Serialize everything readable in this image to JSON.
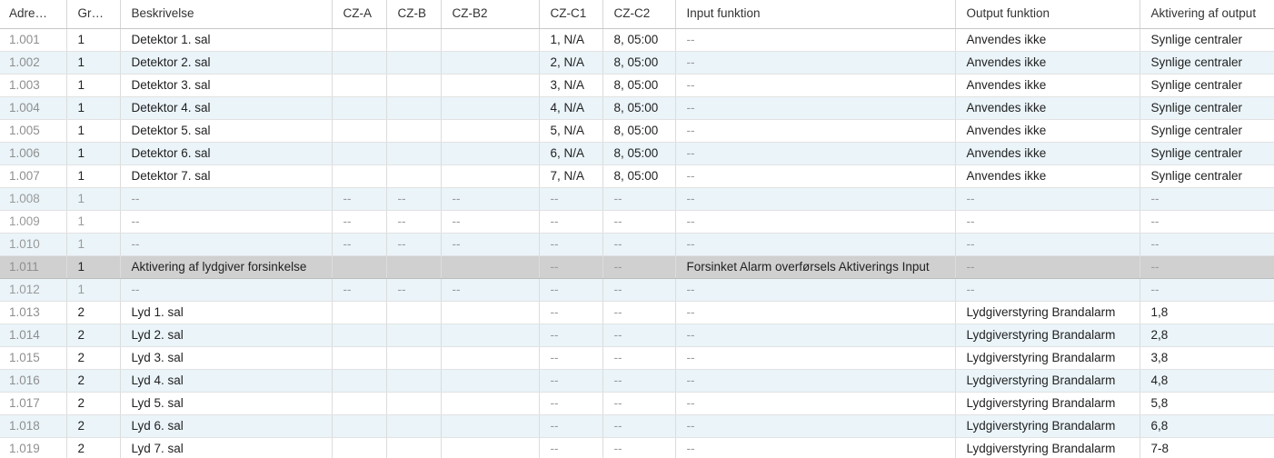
{
  "columns": [
    "Adre…",
    "Gr…",
    "Beskrivelse",
    "CZ-A",
    "CZ-B",
    "CZ-B2",
    "CZ-C1",
    "CZ-C2",
    "Input funktion",
    "Output funktion",
    "Aktivering af output"
  ],
  "rows": [
    {
      "state": "normal",
      "cells": [
        "1.001",
        "1",
        "Detektor 1. sal",
        "",
        "",
        "",
        "1, N/A",
        "8, 05:00",
        "--",
        "Anvendes ikke",
        "Synlige centraler"
      ]
    },
    {
      "state": "normal",
      "cells": [
        "1.002",
        "1",
        "Detektor 2. sal",
        "",
        "",
        "",
        "2, N/A",
        "8, 05:00",
        "--",
        "Anvendes ikke",
        "Synlige centraler"
      ]
    },
    {
      "state": "normal",
      "cells": [
        "1.003",
        "1",
        "Detektor 3. sal",
        "",
        "",
        "",
        "3, N/A",
        "8, 05:00",
        "--",
        "Anvendes ikke",
        "Synlige centraler"
      ]
    },
    {
      "state": "normal",
      "cells": [
        "1.004",
        "1",
        "Detektor 4. sal",
        "",
        "",
        "",
        "4, N/A",
        "8, 05:00",
        "--",
        "Anvendes ikke",
        "Synlige centraler"
      ]
    },
    {
      "state": "normal",
      "cells": [
        "1.005",
        "1",
        "Detektor 5. sal",
        "",
        "",
        "",
        "5, N/A",
        "8, 05:00",
        "--",
        "Anvendes ikke",
        "Synlige centraler"
      ]
    },
    {
      "state": "normal",
      "cells": [
        "1.006",
        "1",
        "Detektor 6. sal",
        "",
        "",
        "",
        "6, N/A",
        "8, 05:00",
        "--",
        "Anvendes ikke",
        "Synlige centraler"
      ]
    },
    {
      "state": "normal",
      "cells": [
        "1.007",
        "1",
        "Detektor 7. sal",
        "",
        "",
        "",
        "7, N/A",
        "8, 05:00",
        "--",
        "Anvendes ikke",
        "Synlige centraler"
      ]
    },
    {
      "state": "disabled",
      "cells": [
        "1.008",
        "1",
        "--",
        "--",
        "--",
        "--",
        "--",
        "--",
        "--",
        "--",
        "--"
      ]
    },
    {
      "state": "disabled",
      "cells": [
        "1.009",
        "1",
        "--",
        "--",
        "--",
        "--",
        "--",
        "--",
        "--",
        "--",
        "--"
      ]
    },
    {
      "state": "disabled",
      "cells": [
        "1.010",
        "1",
        "--",
        "--",
        "--",
        "--",
        "--",
        "--",
        "--",
        "--",
        "--"
      ]
    },
    {
      "state": "selected",
      "cells": [
        "1.011",
        "1",
        "Aktivering af lydgiver forsinkelse",
        "",
        "",
        "",
        "--",
        "--",
        "Forsinket Alarm overførsels Aktiverings Input",
        "--",
        "--"
      ]
    },
    {
      "state": "disabled",
      "cells": [
        "1.012",
        "1",
        "--",
        "--",
        "--",
        "--",
        "--",
        "--",
        "--",
        "--",
        "--"
      ]
    },
    {
      "state": "normal",
      "cells": [
        "1.013",
        "2",
        "Lyd 1. sal",
        "",
        "",
        "",
        "--",
        "--",
        "--",
        "Lydgiverstyring Brandalarm",
        "1,8"
      ]
    },
    {
      "state": "normal",
      "cells": [
        "1.014",
        "2",
        "Lyd 2. sal",
        "",
        "",
        "",
        "--",
        "--",
        "--",
        "Lydgiverstyring Brandalarm",
        "2,8"
      ]
    },
    {
      "state": "normal",
      "cells": [
        "1.015",
        "2",
        "Lyd 3. sal",
        "",
        "",
        "",
        "--",
        "--",
        "--",
        "Lydgiverstyring Brandalarm",
        "3,8"
      ]
    },
    {
      "state": "normal",
      "cells": [
        "1.016",
        "2",
        "Lyd 4. sal",
        "",
        "",
        "",
        "--",
        "--",
        "--",
        "Lydgiverstyring Brandalarm",
        "4,8"
      ]
    },
    {
      "state": "normal",
      "cells": [
        "1.017",
        "2",
        "Lyd 5. sal",
        "",
        "",
        "",
        "--",
        "--",
        "--",
        "Lydgiverstyring Brandalarm",
        "5,8"
      ]
    },
    {
      "state": "normal",
      "cells": [
        "1.018",
        "2",
        "Lyd 6. sal",
        "",
        "",
        "",
        "--",
        "--",
        "--",
        "Lydgiverstyring Brandalarm",
        "6,8"
      ]
    },
    {
      "state": "normal",
      "cells": [
        "1.019",
        "2",
        "Lyd 7. sal",
        "",
        "",
        "",
        "--",
        "--",
        "--",
        "Lydgiverstyring Brandalarm",
        "7-8"
      ]
    }
  ],
  "colors": {
    "row_alt": "#eaf4f9",
    "row_selected": "#d0d0d0",
    "text_muted": "#9a9a9a"
  }
}
